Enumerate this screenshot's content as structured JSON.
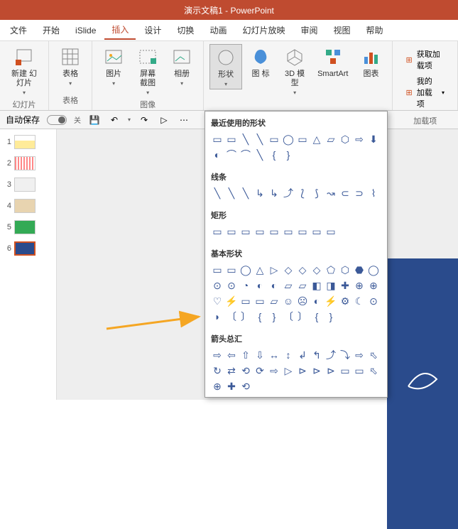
{
  "title": "演示文稿1  -  PowerPoint",
  "menu": [
    "文件",
    "开始",
    "iSlide",
    "插入",
    "设计",
    "切换",
    "动画",
    "幻灯片放映",
    "审阅",
    "视图",
    "帮助"
  ],
  "menu_active_index": 3,
  "ribbon": {
    "groups": [
      {
        "label": "幻灯片",
        "buttons": [
          {
            "name": "new-slide",
            "label": "新建\n幻灯片",
            "drop": true
          }
        ]
      },
      {
        "label": "表格",
        "buttons": [
          {
            "name": "table",
            "label": "表格",
            "drop": true
          }
        ]
      },
      {
        "label": "图像",
        "buttons": [
          {
            "name": "picture",
            "label": "图片",
            "drop": true
          },
          {
            "name": "screenshot",
            "label": "屏幕截图",
            "drop": true
          },
          {
            "name": "album",
            "label": "相册",
            "drop": true
          }
        ]
      },
      {
        "label": "",
        "buttons": [
          {
            "name": "shapes",
            "label": "形状",
            "drop": true,
            "active": true
          },
          {
            "name": "icons",
            "label": "图\n标"
          },
          {
            "name": "3d",
            "label": "3D\n模型",
            "drop": true
          },
          {
            "name": "smartart",
            "label": "SmartArt"
          },
          {
            "name": "chart",
            "label": "图表"
          }
        ]
      }
    ],
    "right": [
      {
        "name": "get-addins",
        "label": "获取加载项"
      },
      {
        "name": "my-addins",
        "label": "我的加载项",
        "drop": true
      }
    ],
    "right_label": "加载项"
  },
  "quickbar": {
    "autosave": "自动保存",
    "off": "关"
  },
  "slides": [
    1,
    2,
    3,
    4,
    5,
    6
  ],
  "shape_menu": {
    "sections": [
      {
        "title": "最近使用的形状",
        "rows": [
          [
            "▭",
            "▭",
            "╲",
            "╲",
            "▭",
            "◯",
            "▭",
            "△",
            "▱",
            "⬡",
            "⇨",
            "⬇"
          ],
          [
            "◐",
            "⌒",
            "⌒",
            "╲",
            "{",
            "}"
          ]
        ]
      },
      {
        "title": "线条",
        "rows": [
          [
            "╲",
            "╲",
            "╲",
            "↳",
            "↳",
            "⤴",
            "⟅",
            "⟆",
            "↝",
            "⊂",
            "⊃",
            "⌇"
          ]
        ]
      },
      {
        "title": "矩形",
        "rows": [
          [
            "▭",
            "▭",
            "▭",
            "▭",
            "▭",
            "▭",
            "▭",
            "▭",
            "▭"
          ]
        ]
      },
      {
        "title": "基本形状",
        "rows": [
          [
            "▭",
            "▭",
            "◯",
            "△",
            "▷",
            "◇",
            "◇",
            "◇",
            "⬠",
            "⬡",
            "⬣",
            "◯"
          ],
          [
            "⊙",
            "⊙",
            "◔",
            "◐",
            "◐",
            "▱",
            "▱",
            "◧",
            "◨",
            "✚",
            "⊕",
            "⊕"
          ],
          [
            "♡",
            "⚡",
            "▭",
            "▭",
            "▱",
            "☺",
            "☹",
            "◐",
            "⚡",
            "⚙",
            "☾",
            "⊙"
          ],
          [
            "◗",
            "〔",
            "〕",
            "{",
            "}",
            "〔",
            "〕",
            "{",
            "}"
          ]
        ]
      },
      {
        "title": "箭头总汇",
        "rows": [
          [
            "⇨",
            "⇦",
            "⇧",
            "⇩",
            "↔",
            "↕",
            "↲",
            "↰",
            "⤴",
            "⤵",
            "⇨",
            "⬁"
          ],
          [
            "↻",
            "⇄",
            "⟲",
            "⟳",
            "⇨",
            "▷",
            "⊳",
            "⊳",
            "⊳",
            "▭",
            "▭",
            "⬁"
          ],
          [
            "⊕",
            "✚",
            "⟲"
          ]
        ]
      }
    ]
  }
}
